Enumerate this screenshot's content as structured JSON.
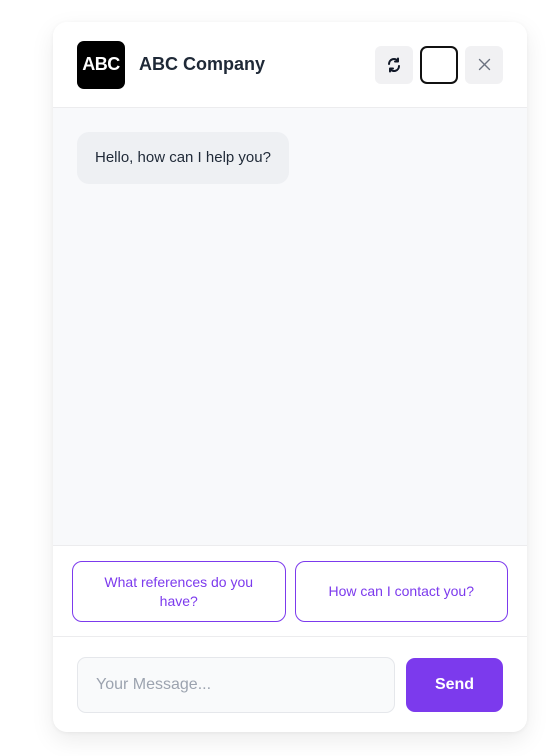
{
  "header": {
    "logo_text": "ABC",
    "company_name": "ABC Company",
    "actions": {
      "refresh_icon": "refresh-icon",
      "theme_icon": "moon-icon",
      "close_icon": "close-icon"
    }
  },
  "messages": [
    {
      "from": "bot",
      "text": "Hello, how can I help you?"
    }
  ],
  "suggestions": [
    "What references do you have?",
    "How can I contact you?"
  ],
  "composer": {
    "placeholder": "Your Message...",
    "value": "",
    "send_label": "Send"
  },
  "colors": {
    "accent": "#7c3aed",
    "logo_bg": "#000000",
    "bubble_bg": "#eef0f3"
  }
}
